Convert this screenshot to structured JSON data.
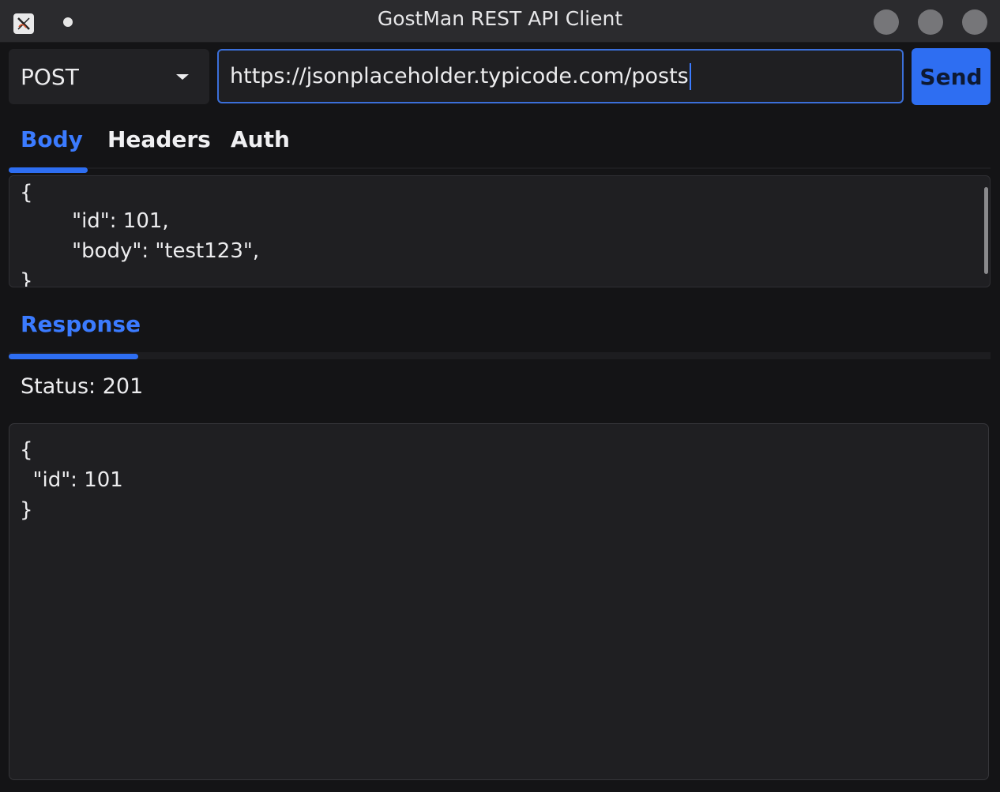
{
  "window": {
    "title": "GostMan REST API Client"
  },
  "request": {
    "method": "POST",
    "url": "https://jsonplaceholder.typicode.com/posts",
    "send_label": "Send"
  },
  "tabs": [
    {
      "label": "Body",
      "active": true
    },
    {
      "label": "Headers",
      "active": false
    },
    {
      "label": "Auth",
      "active": false
    }
  ],
  "body_editor": {
    "lines": [
      "{",
      "        \"id\": 101,",
      "        \"body\": \"test123\",",
      "}"
    ]
  },
  "response": {
    "tab_label": "Response",
    "status_text": "Status: 201",
    "lines": [
      "{",
      "  \"id\": 101",
      "}"
    ]
  },
  "colors": {
    "accent": "#2e6ef2",
    "background": "#141416",
    "panel": "#1f1f22"
  },
  "icons": {
    "app": "app-x-icon",
    "method_dropdown": "caret-down-icon"
  }
}
